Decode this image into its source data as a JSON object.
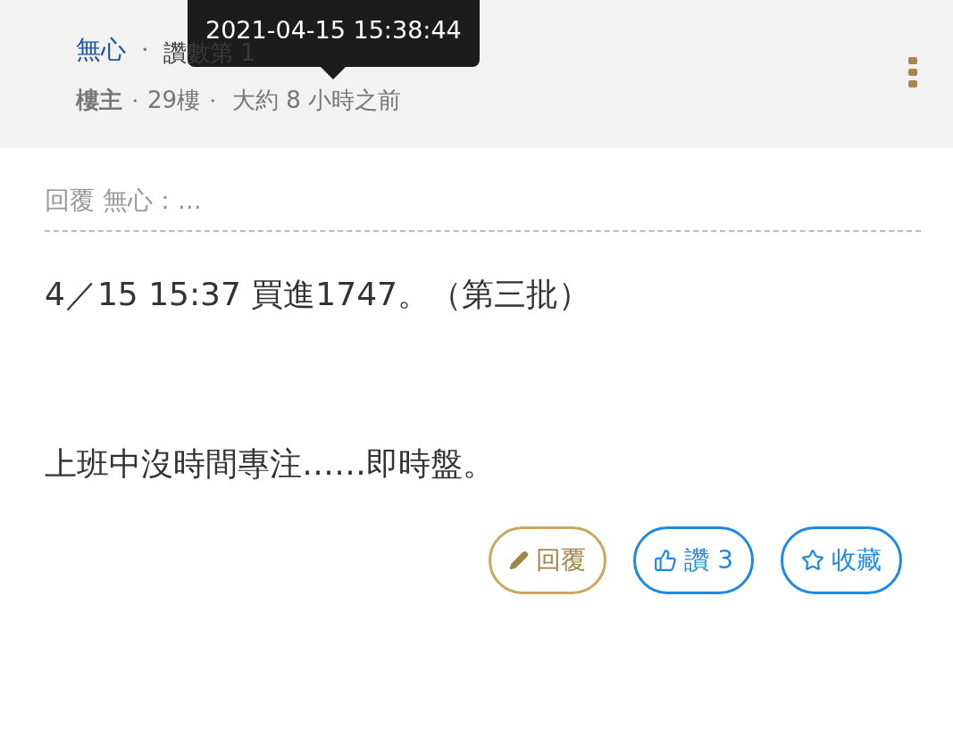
{
  "header": {
    "author": "無心",
    "separator": "・",
    "rank": "讚數第 1",
    "role": "樓主",
    "floor": "29樓",
    "time": "大約 8 小時之前"
  },
  "tooltip": {
    "text": "2021-04-15 15:38:44"
  },
  "quote": {
    "text": "回覆 無心：..."
  },
  "body": {
    "lines": [
      "4／15 15:37 買進1747。（第三批）",
      "上班中沒時間專注……即時盤。"
    ]
  },
  "actions": [
    {
      "kind": "reply",
      "label": "回覆"
    },
    {
      "kind": "like",
      "label": "讚 3"
    },
    {
      "kind": "favorite",
      "label": "收藏"
    }
  ]
}
